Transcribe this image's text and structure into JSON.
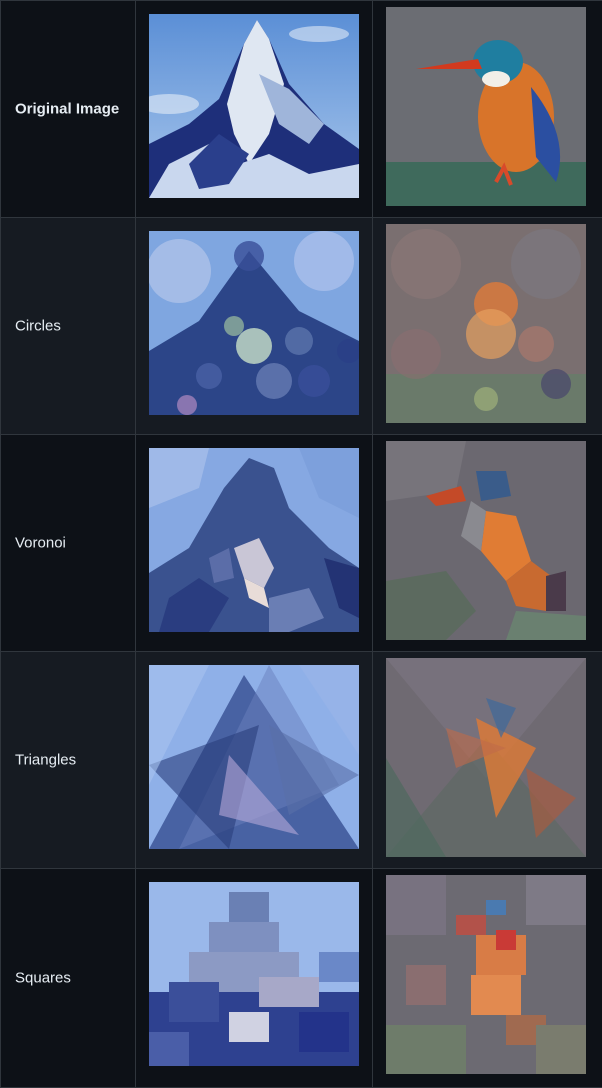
{
  "rows": [
    {
      "label": "Original Image"
    },
    {
      "label": "Circles"
    },
    {
      "label": "Voronoi"
    },
    {
      "label": "Triangles"
    },
    {
      "label": "Squares"
    }
  ],
  "colors": {
    "background": "#0d1117",
    "row_alt": "#161b22",
    "border": "#30363d",
    "text": "#e6edf3"
  },
  "images": {
    "left_subject": "matterhorn-mountain",
    "right_subject": "kingfisher-bird"
  }
}
